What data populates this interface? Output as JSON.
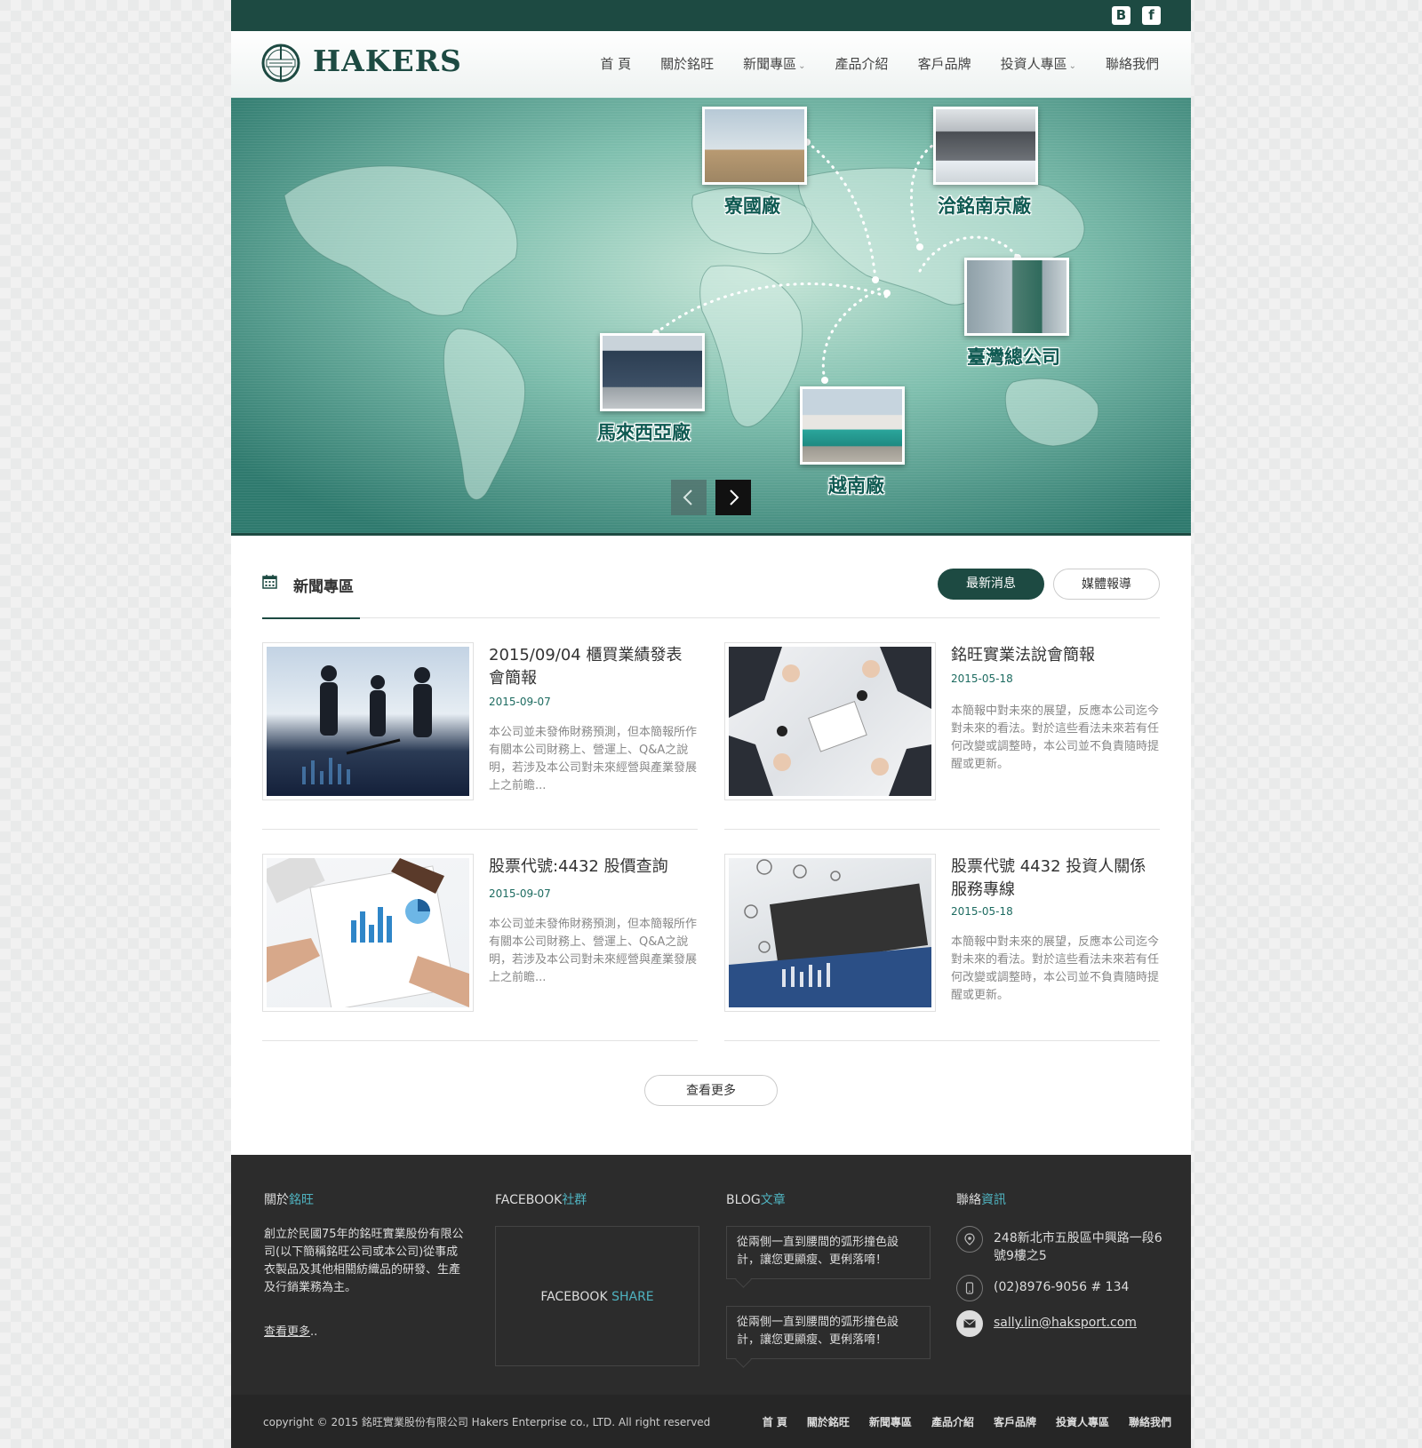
{
  "social": {
    "blogger": "B",
    "facebook": "f"
  },
  "brand": {
    "name": "HAKERS"
  },
  "nav": {
    "items": [
      {
        "label": "首 頁"
      },
      {
        "label": "關於銘旺"
      },
      {
        "label": "新聞專區",
        "dropdown": true
      },
      {
        "label": "產品介紹"
      },
      {
        "label": "客戶品牌"
      },
      {
        "label": "投資人專區",
        "dropdown": true
      },
      {
        "label": "聯絡我們"
      }
    ]
  },
  "hero": {
    "locations": {
      "thailand": "寮國廠",
      "nanjing": "洽銘南京廠",
      "taiwan": "臺灣總公司",
      "malaysia": "馬來西亞廠",
      "vietnam": "越南廠"
    },
    "prev_icon": "chevron-left-icon",
    "next_icon": "chevron-right-icon"
  },
  "news": {
    "title": "新聞專區",
    "tabs": {
      "latest": "最新消息",
      "media": "媒體報導"
    },
    "articles": [
      {
        "title": "2015/09/04 櫃買業績發表會簡報",
        "date": "2015-09-07",
        "desc": "本公司並未發佈財務預測，但本簡報所作有關本公司財務上、營運上、Q&A之說明，若涉及本公司對未來經營與產業發展上之前瞻..."
      },
      {
        "title": "銘旺實業法說會簡報",
        "date": "2015-05-18",
        "desc": "本簡報中對未來的展望，反應本公司迄今對未來的看法。對於這些看法未來若有任何改變或調整時，本公司並不負責隨時提醒或更新。"
      },
      {
        "title": "股票代號:4432 股價查詢",
        "date": "2015-09-07",
        "desc": "本公司並未發佈財務預測，但本簡報所作有關本公司財務上、營運上、Q&A之說明，若涉及本公司對未來經營與產業發展上之前瞻..."
      },
      {
        "title": "股票代號 4432 投資人關係服務專線",
        "date": "2015-05-18",
        "desc": "本簡報中對未來的展望，反應本公司迄今對未來的看法。對於這些看法未來若有任何改變或調整時，本公司並不負責隨時提醒或更新。"
      }
    ],
    "more_label": "查看更多"
  },
  "footer": {
    "about": {
      "head_a": "關於",
      "head_b": "銘旺",
      "text": "創立於民國75年的銘旺實業股份有限公司(以下簡稱銘旺公司或本公司)從事成衣製品及其他相關紡織品的研發、生產及行銷業務為主。",
      "more": "查看更多",
      "more_suffix": ".."
    },
    "facebook": {
      "head_a": "FACEBOOK",
      "head_b": "社群",
      "box_a": "FACEBOOK ",
      "box_b": "SHARE"
    },
    "blog": {
      "head_a": "BLOG",
      "head_b": "文章",
      "posts": [
        "從兩側一直到腰間的弧形撞色設計，讓您更顯瘦、更俐落唷！",
        "從兩側一直到腰間的弧形撞色設計，讓您更顯瘦、更俐落唷！"
      ]
    },
    "contact": {
      "head_a": "聯絡",
      "head_b": "資訊",
      "address": "248新北市五股區中興路一段6號9樓之5",
      "phone": "(02)8976-9056 # 134",
      "email": "sally.lin@haksport.com"
    },
    "copyright": "copyright © 2015 銘旺實業股份有限公司 Hakers Enterprise co., LTD. All right reserved",
    "nav": [
      "首 頁",
      "關於銘旺",
      "新聞專區",
      "產品介紹",
      "客戶品牌",
      "投資人專區",
      "聯絡我們"
    ]
  },
  "colors": {
    "brand": "#1d4a42",
    "accent": "#4fb3c0",
    "footer": "#2c2c2c"
  }
}
